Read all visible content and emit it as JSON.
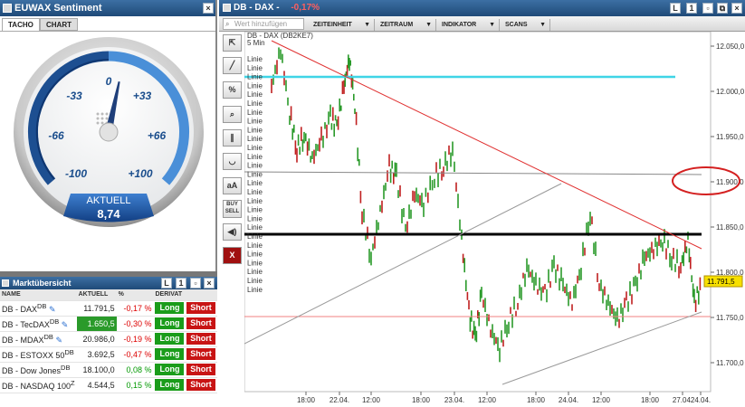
{
  "sentiment": {
    "title": "EUWAX Sentiment",
    "tabs": [
      "TACHO",
      "CHART"
    ],
    "scale": [
      "0",
      "-33",
      "+33",
      "-66",
      "+66",
      "-100",
      "+100"
    ],
    "aktuell_label": "AKTUELL",
    "aktuell_value": "8,74",
    "value": 8.74
  },
  "market": {
    "title": "Marktübersicht",
    "headers": [
      "NAME",
      "AKTUELL",
      "%",
      "DERIVAT"
    ],
    "rows": [
      {
        "name": "DB - DAX",
        "sup": "DB",
        "value": "11.791,5",
        "pct": "-0,17 %",
        "long": "Long",
        "short": "Short"
      },
      {
        "name": "DB - TecDAX",
        "sup": "DB",
        "value": "1.650,5",
        "pct": "-0,30 %",
        "long": "Long",
        "short": "Short"
      },
      {
        "name": "DB - MDAX",
        "sup": "DB",
        "value": "20.986,0",
        "pct": "-0,19 %",
        "long": "Long",
        "short": "Short"
      },
      {
        "name": "DB - ESTOXX 50",
        "sup": "DB",
        "value": "3.692,5",
        "pct": "-0,47 %",
        "long": "Long",
        "short": "Short"
      },
      {
        "name": "DB - Dow Jones",
        "sup": "DB",
        "value": "18.100,0",
        "pct": "0,08 %",
        "long": "Long",
        "short": "Short"
      },
      {
        "name": "DB - NASDAQ 100",
        "sup": "Z",
        "value": "4.544,5",
        "pct": "0,15 %",
        "long": "Long",
        "short": "Short"
      }
    ]
  },
  "chart_window": {
    "title": "DB - DAX -",
    "change": "-0,17%",
    "search_placeholder": "Wert hinzufügen",
    "menus": [
      "ZEITEINHEIT",
      "ZEITRAUM",
      "INDIKATOR",
      "SCANS"
    ],
    "instrument": "DB - DAX (DB2KE7)",
    "interval": "5 Min",
    "linie_label": "Linie",
    "linie_count": 27,
    "tools": [
      "arrow",
      "line",
      "%",
      "zoom",
      "//",
      "curve",
      "aA",
      "BUY SELL",
      "sound",
      "X"
    ]
  },
  "chart_data": {
    "type": "line",
    "y_ticks": [
      "12.050,0",
      "12.000,0",
      "11.950,0",
      "11.900,0",
      "11.850,0",
      "11.800,0",
      "11.750,0",
      "11.700,0"
    ],
    "x_ticks": [
      "18:00",
      "22.04.",
      "12:00",
      "18:00",
      "23.04.",
      "12:00",
      "18:00",
      "24.04.",
      "12:00",
      "18:00",
      "27.04.",
      "24.04."
    ],
    "last_price": "11.791,5",
    "ylim": [
      11675,
      12075
    ]
  },
  "colors": {
    "accent": "#1f4a78",
    "long": "#1a9c1a",
    "short": "#c81414",
    "cyan": "#3fd5e6",
    "circle": "#d42020"
  }
}
